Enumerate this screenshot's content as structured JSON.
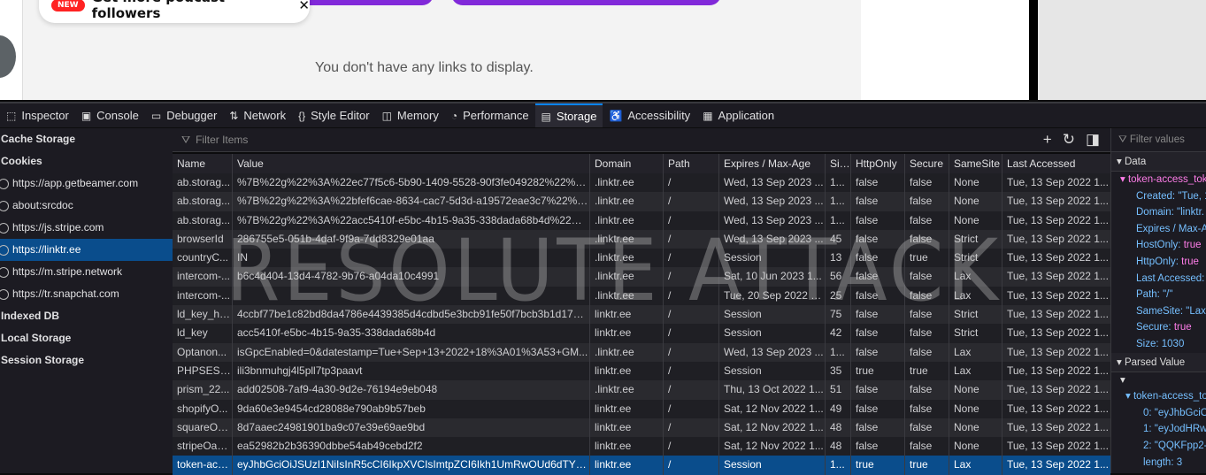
{
  "webpage": {
    "popup_badge": "NEW",
    "popup_text": "Get more podcast followers",
    "popup_close": "✕",
    "empty_message": "You don't have any links to display."
  },
  "toolbar": {
    "tabs": [
      {
        "icon": "⬚",
        "label": "Inspector"
      },
      {
        "icon": "▣",
        "label": "Console"
      },
      {
        "icon": "▭",
        "label": "Debugger"
      },
      {
        "icon": "⇅",
        "label": "Network"
      },
      {
        "icon": "{}",
        "label": "Style Editor"
      },
      {
        "icon": "◫",
        "label": "Memory"
      },
      {
        "icon": "◔",
        "label": "Performance"
      },
      {
        "icon": "▤",
        "label": "Storage"
      },
      {
        "icon": "♿",
        "label": "Accessibility"
      },
      {
        "icon": "▦",
        "label": "Application"
      }
    ]
  },
  "sidebar": {
    "cache_storage": "Cache Storage",
    "cookies": "Cookies",
    "cookie_hosts": [
      "https://app.getbeamer.com",
      "about:srcdoc",
      "https://js.stripe.com",
      "https://linktr.ee",
      "https://m.stripe.network",
      "https://tr.snapchat.com"
    ],
    "indexed_db": "Indexed DB",
    "local_storage": "Local Storage",
    "session_storage": "Session Storage"
  },
  "filter": {
    "placeholder": "Filter Items",
    "add": "+",
    "refresh": "↻",
    "toggle": "◨"
  },
  "table": {
    "headers": [
      "Name",
      "Value",
      "Domain",
      "Path",
      "Expires / Max-Age",
      "Size",
      "HttpOnly",
      "Secure",
      "SameSite",
      "Last Accessed"
    ],
    "rows": [
      [
        "ab.storag...",
        "%7B%22g%22%3A%22ec77f5c6-5b90-1409-5528-90f3fe049282%22%2...",
        ".linktr.ee",
        "/",
        "Wed, 13 Sep 2023 ...",
        "1...",
        "false",
        "false",
        "None",
        "Tue, 13 Sep 2022 1..."
      ],
      [
        "ab.storag...",
        "%7B%22g%22%3A%22bfef6cae-8634-cac7-5d3d-a19572eae3c7%22%2C...",
        ".linktr.ee",
        "/",
        "Wed, 13 Sep 2023 ...",
        "1...",
        "false",
        "false",
        "None",
        "Tue, 13 Sep 2022 1..."
      ],
      [
        "ab.storag...",
        "%7B%22g%22%3A%22acc5410f-e5bc-4b15-9a35-338dada68b4d%22%2...",
        ".linktr.ee",
        "/",
        "Wed, 13 Sep 2023 ...",
        "1...",
        "false",
        "false",
        "None",
        "Tue, 13 Sep 2022 1..."
      ],
      [
        "browserId",
        "286755e5-051b-4daf-9f9a-7dd8329e01aa",
        ".linktr.ee",
        "/",
        "Wed, 13 Sep 2023 ...",
        "45",
        "false",
        "false",
        "Strict",
        "Tue, 13 Sep 2022 1..."
      ],
      [
        "countryC...",
        "IN",
        ".linktr.ee",
        "/",
        "Session",
        "13",
        "false",
        "true",
        "Strict",
        "Tue, 13 Sep 2022 1..."
      ],
      [
        "intercom-...",
        "b6c4d404-13d4-4782-9b76-a04da10c4991",
        ".linktr.ee",
        "/",
        "Sat, 10 Jun 2023 1...",
        "56",
        "false",
        "false",
        "Lax",
        "Tue, 13 Sep 2022 1..."
      ],
      [
        "intercom-...",
        "",
        ".linktr.ee",
        "/",
        "Tue, 20 Sep 2022 1...",
        "25",
        "false",
        "false",
        "Lax",
        "Tue, 13 Sep 2022 1..."
      ],
      [
        "ld_key_ha...",
        "4ccbf77be1c82bd8da4786e4439385d4cdbd5e3bcb91fe50f7bcb3b1d17e2...",
        "linktr.ee",
        "/",
        "Session",
        "75",
        "false",
        "false",
        "Strict",
        "Tue, 13 Sep 2022 1..."
      ],
      [
        "ld_key",
        "acc5410f-e5bc-4b15-9a35-338dada68b4d",
        "linktr.ee",
        "/",
        "Session",
        "42",
        "false",
        "false",
        "Strict",
        "Tue, 13 Sep 2022 1..."
      ],
      [
        "Optanon...",
        "isGpcEnabled=0&datestamp=Tue+Sep+13+2022+18%3A01%3A53+GM...",
        ".linktr.ee",
        "/",
        "Wed, 13 Sep 2023 ...",
        "1...",
        "false",
        "false",
        "Lax",
        "Tue, 13 Sep 2022 1..."
      ],
      [
        "PHPSESSID",
        "ili3bnmuhgj4l5pll7tp3paavt",
        "linktr.ee",
        "/",
        "Session",
        "35",
        "true",
        "true",
        "Lax",
        "Tue, 13 Sep 2022 1..."
      ],
      [
        "prism_22...",
        "add02508-7af9-4a30-9d2e-76194e9eb048",
        ".linktr.ee",
        "/",
        "Thu, 13 Oct 2022 1...",
        "51",
        "false",
        "false",
        "None",
        "Tue, 13 Sep 2022 1..."
      ],
      [
        "shopifyO...",
        "9da60e3e9454cd28088e790ab9b57beb",
        "linktr.ee",
        "/",
        "Sat, 12 Nov 2022 1...",
        "49",
        "false",
        "false",
        "None",
        "Tue, 13 Sep 2022 1..."
      ],
      [
        "squareOa...",
        "8d7aaec24981901ba9c07e39e69ae9bd",
        "linktr.ee",
        "/",
        "Sat, 12 Nov 2022 1...",
        "48",
        "false",
        "false",
        "None",
        "Tue, 13 Sep 2022 1..."
      ],
      [
        "stripeOau...",
        "ea52982b2b36390dbbe54ab49cebd2f2",
        "linktr.ee",
        "/",
        "Sat, 12 Nov 2022 1...",
        "48",
        "false",
        "false",
        "None",
        "Tue, 13 Sep 2022 1..."
      ],
      [
        "token-acc...",
        "eyJhbGciOiJSUzI1NiIsInR5cCI6IkpXVCIsImtpZCI6Ikh1UmRwOUd6dTY2ZXJ...",
        "linktr.ee",
        "/",
        "Session",
        "1...",
        "true",
        "true",
        "Lax",
        "Tue, 13 Sep 2022 1..."
      ]
    ]
  },
  "watermark": "RESOLUTE ATTACK",
  "details": {
    "filter_placeholder": "Filter values",
    "data_header": "Data",
    "key": "token-access_tok",
    "props": [
      [
        "Created: ",
        "\"Tue, 1"
      ],
      [
        "Domain: ",
        "\"linktr."
      ],
      [
        "Expires / Max-A",
        ""
      ],
      [
        "HostOnly: ",
        "true"
      ],
      [
        "HttpOnly: ",
        "true"
      ],
      [
        "Last Accessed: ",
        "\""
      ],
      [
        "Path: ",
        "\"/\""
      ],
      [
        "SameSite: ",
        "\"Lax\""
      ],
      [
        "Secure: ",
        "true"
      ],
      [
        "Size: ",
        "1030"
      ]
    ],
    "parsed_header": "Parsed Value",
    "parsed_key": "token-access_to",
    "parsed_items": [
      "0: \"eyJhbGciO",
      "1: \"eyJodHRwe",
      "2: \"QQKFpp2-",
      "length: 3"
    ]
  }
}
